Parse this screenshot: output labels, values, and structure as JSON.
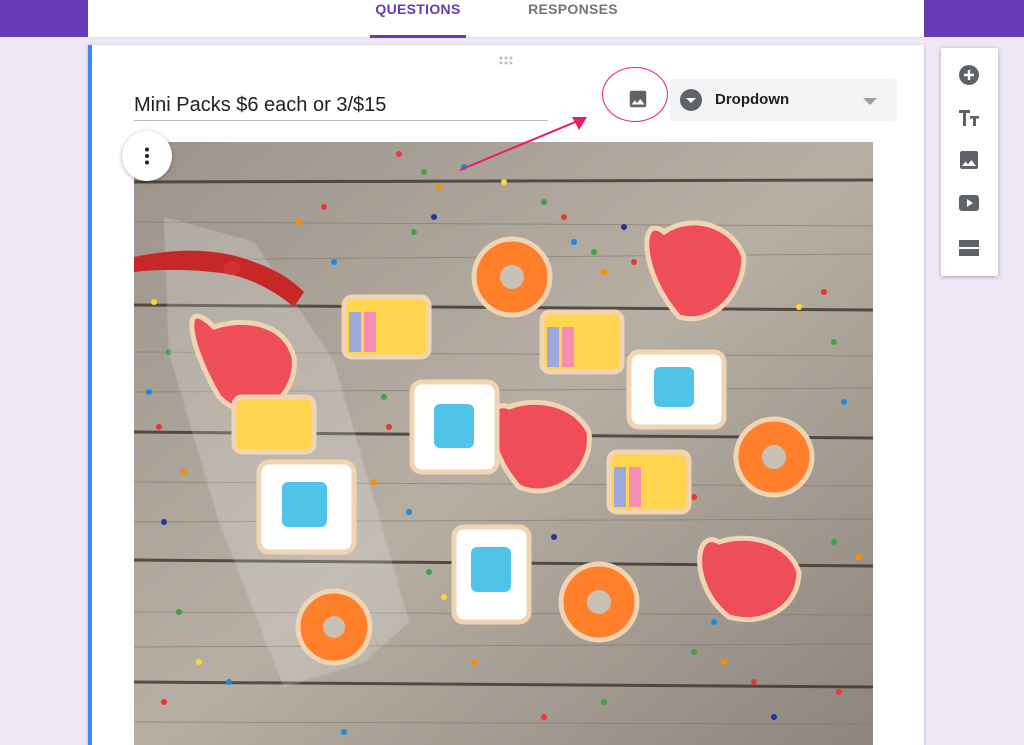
{
  "tabs": [
    {
      "label": "QUESTIONS",
      "active": true
    },
    {
      "label": "RESPONSES",
      "active": false
    }
  ],
  "question": {
    "title": "Mini Packs $6 each or 3/$15",
    "type": "Dropdown"
  },
  "icons": {
    "add_image": "image-icon",
    "type_dropdown": "arrow-drop-down-circle-icon",
    "more": "more-vert-icon",
    "drag": "drag-handle-icon"
  },
  "toolbar": [
    {
      "name": "add-question",
      "icon": "add-circle-icon"
    },
    {
      "name": "add-title",
      "icon": "title-text-icon"
    },
    {
      "name": "add-image",
      "icon": "image-icon"
    },
    {
      "name": "add-video",
      "icon": "video-play-icon"
    },
    {
      "name": "add-section",
      "icon": "section-icon"
    }
  ],
  "colors": {
    "brand": "#673ab7",
    "accent": "#4285f4",
    "annotation": "#e91e63",
    "background": "#ede7f6"
  }
}
